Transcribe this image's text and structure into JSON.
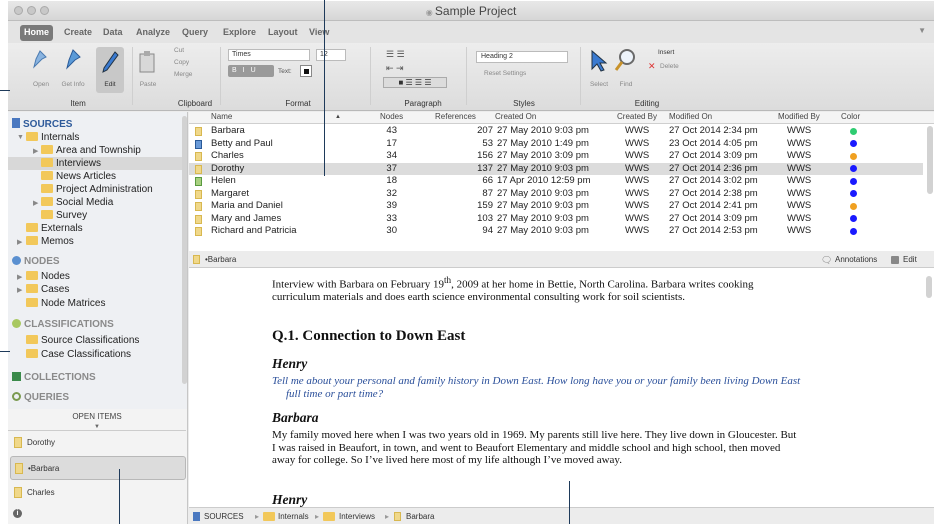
{
  "window": {
    "title": "Sample Project"
  },
  "ribbon_tabs": [
    "Home",
    "Create",
    "Data",
    "Analyze",
    "Query",
    "Explore",
    "Layout",
    "View"
  ],
  "ribbon": {
    "item_buttons": [
      "Open",
      "Get Info",
      "Edit"
    ],
    "clipboard_paste": "Paste",
    "clipboard_items": [
      "Cut",
      "Copy",
      "Merge"
    ],
    "font_name": "Times",
    "font_size": "12",
    "text_label": "Text:",
    "style_value": "Heading 2",
    "reset_settings": "Reset Settings",
    "select": "Select",
    "find": "Find",
    "insert": "Insert",
    "delete": "Delete",
    "groups": [
      "Item",
      "Clipboard",
      "Format",
      "Paragraph",
      "Styles",
      "Editing"
    ]
  },
  "sidebar": {
    "sources": "SOURCES",
    "internals": "Internals",
    "area": "Area and Township",
    "interviews": "Interviews",
    "news": "News Articles",
    "project_admin": "Project Administration",
    "social": "Social Media",
    "survey": "Survey",
    "externals": "Externals",
    "memos": "Memos",
    "nodes_header": "NODES",
    "nodes": "Nodes",
    "cases": "Cases",
    "node_matrices": "Node Matrices",
    "classifications": "CLASSIFICATIONS",
    "source_class": "Source Classifications",
    "case_class": "Case Classifications",
    "collections": "COLLECTIONS",
    "queries": "QUERIES"
  },
  "open_items": {
    "header": "OPEN ITEMS",
    "items": [
      "Dorothy",
      "•Barbara",
      "Charles"
    ]
  },
  "list": {
    "columns": [
      "Name",
      "Nodes",
      "References",
      "Created On",
      "Created By",
      "Modified On",
      "Modified By",
      "Color"
    ],
    "rows": [
      {
        "name": "Barbara",
        "nodes": "43",
        "refs": "207",
        "created": "27 May 2010 9:03 pm",
        "by": "WWS",
        "modified": "27 Oct 2014 2:34 pm",
        "mby": "WWS",
        "color": "#2ecc71"
      },
      {
        "name": "Betty and Paul",
        "nodes": "17",
        "refs": "53",
        "created": "27 May 2010 1:49 pm",
        "by": "WWS",
        "modified": "23 Oct 2014 4:05 pm",
        "mby": "WWS",
        "color": "#1a1aff"
      },
      {
        "name": "Charles",
        "nodes": "34",
        "refs": "156",
        "created": "27 May 2010 3:09 pm",
        "by": "WWS",
        "modified": "27 Oct 2014 3:09 pm",
        "mby": "WWS",
        "color": "#f0a020"
      },
      {
        "name": "Dorothy",
        "nodes": "37",
        "refs": "137",
        "created": "27 May 2010 9:03 pm",
        "by": "WWS",
        "modified": "27 Oct 2014 2:36 pm",
        "mby": "WWS",
        "color": "#1a1aff"
      },
      {
        "name": "Helen",
        "nodes": "18",
        "refs": "66",
        "created": "17 Apr 2010 12:59 pm",
        "by": "WWS",
        "modified": "27 Oct 2014 3:02 pm",
        "mby": "WWS",
        "color": "#1a1aff"
      },
      {
        "name": "Margaret",
        "nodes": "32",
        "refs": "87",
        "created": "27 May 2010 9:03 pm",
        "by": "WWS",
        "modified": "27 Oct 2014 2:38 pm",
        "mby": "WWS",
        "color": "#1a1aff"
      },
      {
        "name": "Maria and Daniel",
        "nodes": "39",
        "refs": "159",
        "created": "27 May 2010 9:03 pm",
        "by": "WWS",
        "modified": "27 Oct 2014 2:41 pm",
        "mby": "WWS",
        "color": "#f0a020"
      },
      {
        "name": "Mary and James",
        "nodes": "33",
        "refs": "103",
        "created": "27 May 2010 9:03 pm",
        "by": "WWS",
        "modified": "27 Oct 2014 3:09 pm",
        "mby": "WWS",
        "color": "#1a1aff"
      },
      {
        "name": "Richard and Patricia",
        "nodes": "30",
        "refs": "94",
        "created": "27 May 2010 9:03 pm",
        "by": "WWS",
        "modified": "27 Oct 2014 2:53 pm",
        "mby": "WWS",
        "color": "#1a1aff"
      }
    ]
  },
  "doc_bar": {
    "title": "•Barbara",
    "annotations": "Annotations",
    "edit": "Edit"
  },
  "document": {
    "intro_a": "Interview with Barbara on February 19",
    "intro_sup": "th",
    "intro_b": ", 2009 at her home in Bettie, North Carolina. Barbara writes cooking curriculum materials and does earth science environmental consulting work for soil scientists.",
    "heading": "Q.1. Connection to Down East",
    "speaker1": "Henry",
    "question": "Tell me about your personal and family history in Down East. How long have you or your family been living Down East full time or part time?",
    "speaker2": "Barbara",
    "answer": "My family moved here when I was two years old in 1969. My parents still live here. They live down in Gloucester. But I was raised in Beaufort, in town, and went to Beaufort Elementary and middle school and high school, then moved away for college. So I’ve lived here most of my life although I’ve moved away.",
    "speaker3": "Henry"
  },
  "breadcrumb": [
    "SOURCES",
    "Internals",
    "Interviews",
    "Barbara"
  ]
}
